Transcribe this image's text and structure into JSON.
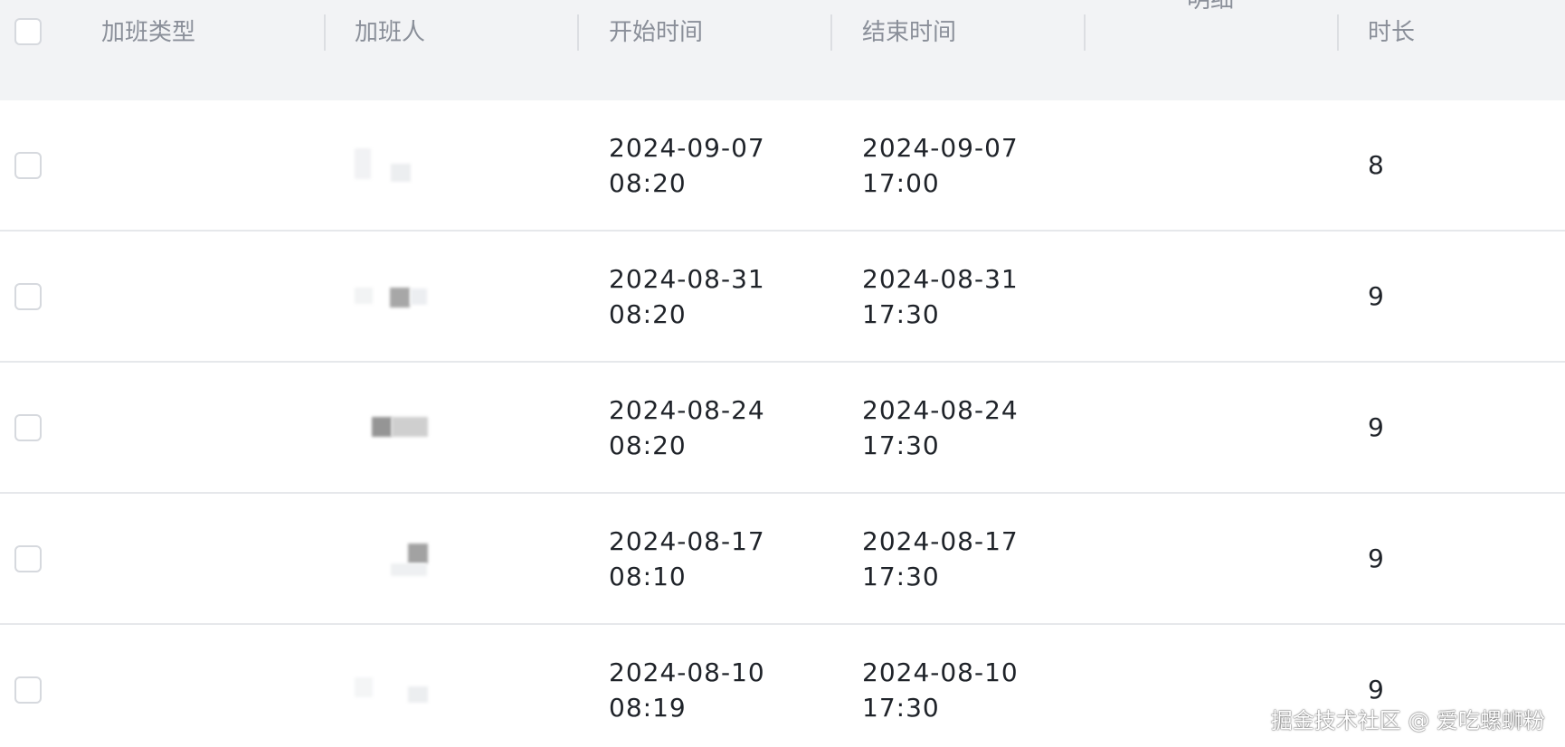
{
  "header": {
    "columns": {
      "type": "加班类型",
      "person": "加班人",
      "start": "开始时间",
      "end": "结束时间",
      "detail": "明细",
      "duration": "时长"
    }
  },
  "rows": [
    {
      "type": "",
      "start_date": "2024-09-07",
      "start_time": "08:20",
      "end_date": "2024-09-07",
      "end_time": "17:00",
      "duration": "8"
    },
    {
      "type": "",
      "start_date": "2024-08-31",
      "start_time": "08:20",
      "end_date": "2024-08-31",
      "end_time": "17:30",
      "duration": "9"
    },
    {
      "type": "",
      "start_date": "2024-08-24",
      "start_time": "08:20",
      "end_date": "2024-08-24",
      "end_time": "17:30",
      "duration": "9"
    },
    {
      "type": "",
      "start_date": "2024-08-17",
      "start_time": "08:10",
      "end_date": "2024-08-17",
      "end_time": "17:30",
      "duration": "9"
    },
    {
      "type": "",
      "start_date": "2024-08-10",
      "start_time": "08:19",
      "end_date": "2024-08-10",
      "end_time": "17:30",
      "duration": "9"
    }
  ],
  "watermark": "掘金技术社区 @ 爱吃螺蛳粉",
  "colors": {
    "header_bg": "#f2f3f5",
    "header_text": "#8a8f99",
    "body_text": "#1f2329",
    "border": "#e6e8eb"
  }
}
